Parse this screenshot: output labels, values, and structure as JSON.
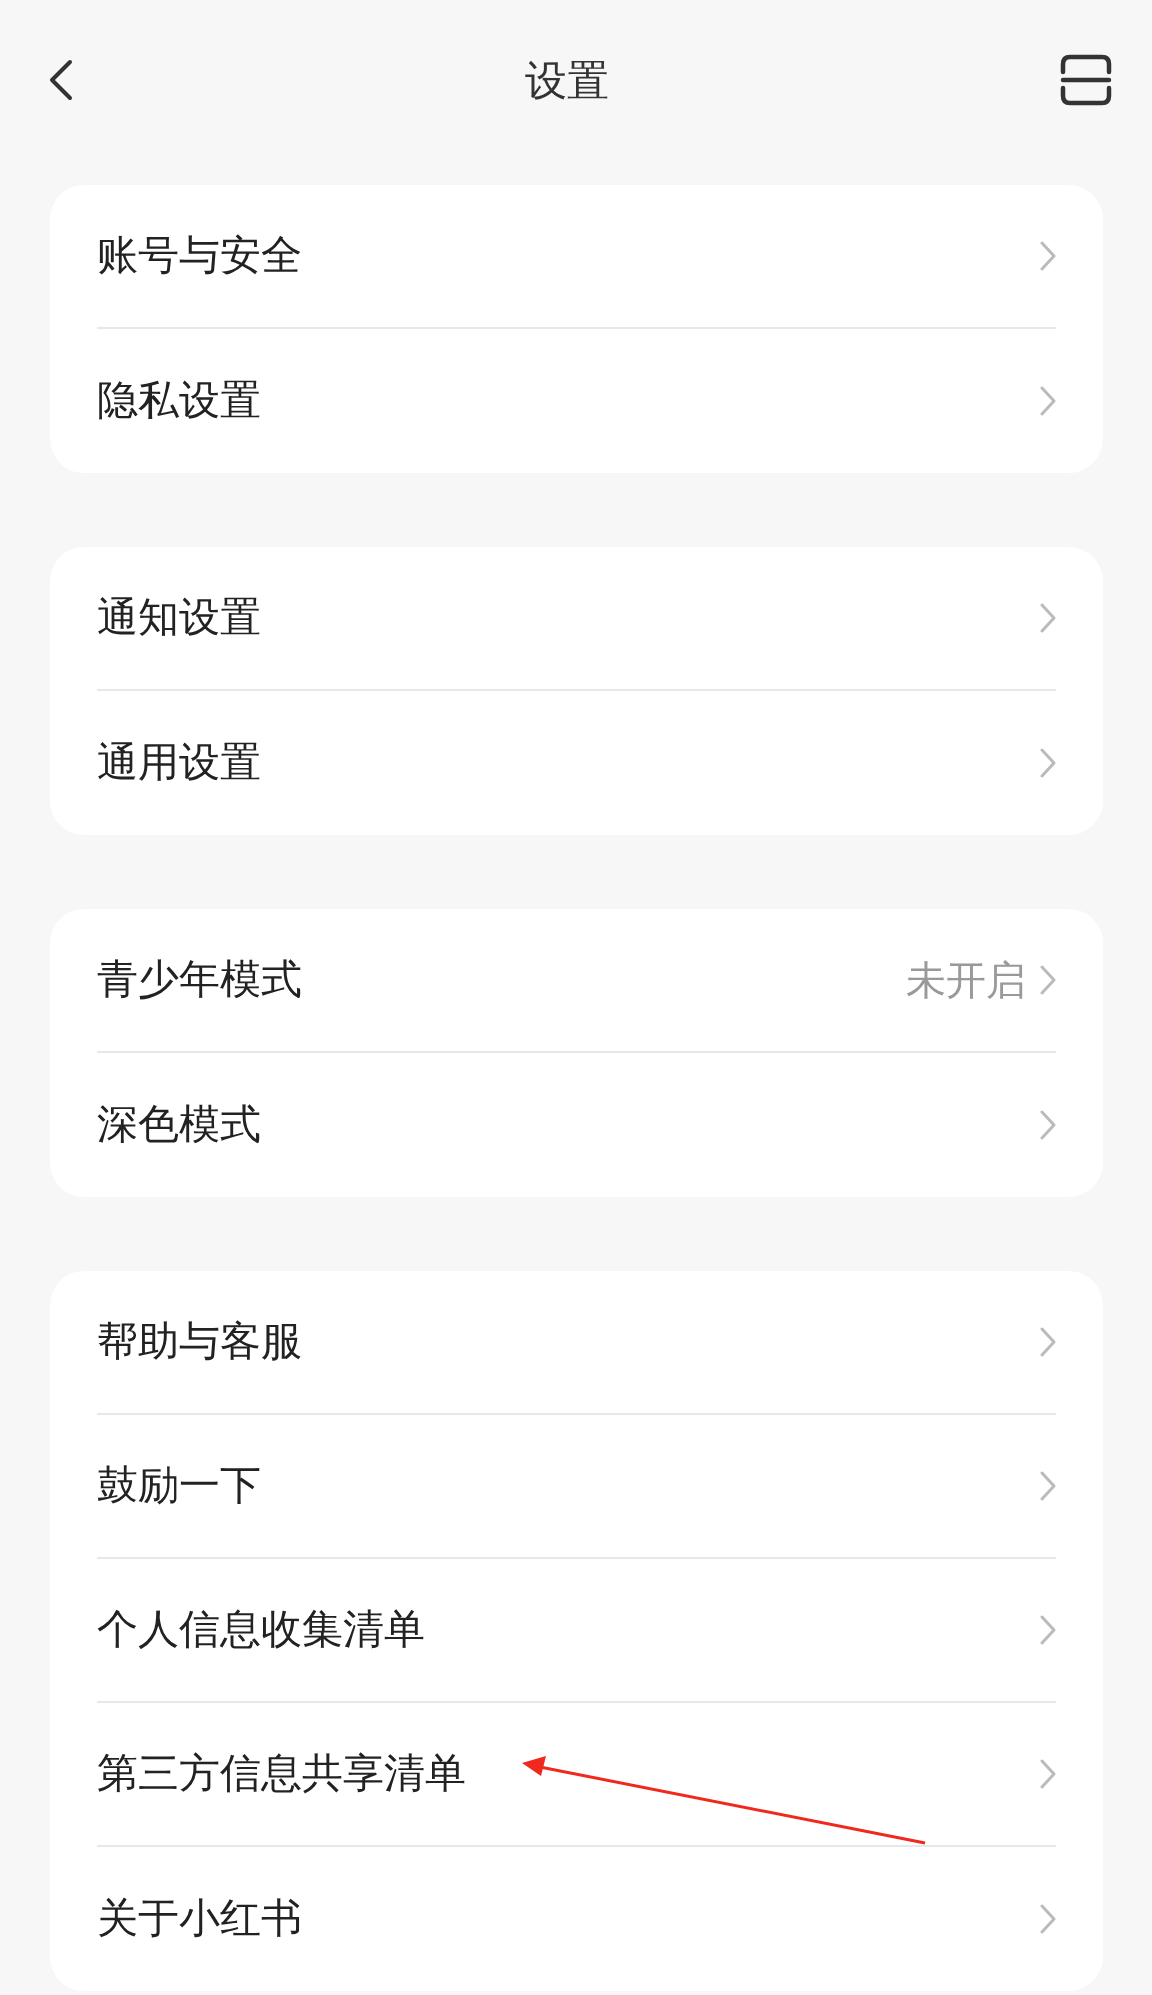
{
  "header": {
    "title": "设置"
  },
  "groups": [
    {
      "items": [
        {
          "label": "账号与安全"
        },
        {
          "label": "隐私设置"
        }
      ]
    },
    {
      "items": [
        {
          "label": "通知设置"
        },
        {
          "label": "通用设置"
        }
      ]
    },
    {
      "items": [
        {
          "label": "青少年模式",
          "value": "未开启"
        },
        {
          "label": "深色模式"
        }
      ]
    },
    {
      "items": [
        {
          "label": "帮助与客服"
        },
        {
          "label": "鼓励一下"
        },
        {
          "label": "个人信息收集清单"
        },
        {
          "label": "第三方信息共享清单"
        },
        {
          "label": "关于小红书"
        }
      ]
    }
  ],
  "annotations": [
    {
      "kind": "arrow"
    }
  ]
}
